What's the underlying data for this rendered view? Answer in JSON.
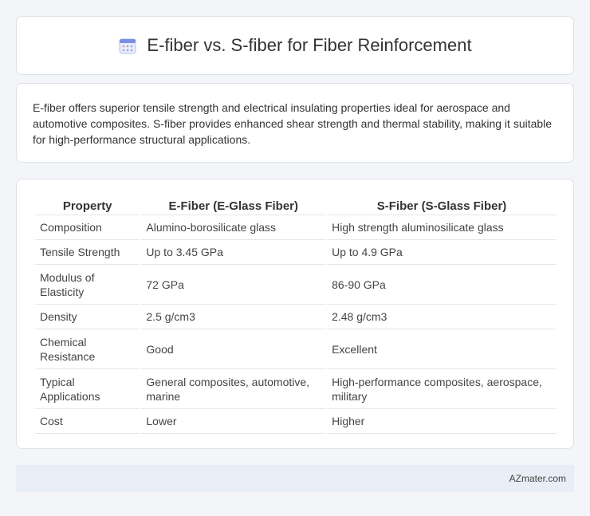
{
  "header": {
    "title": "E-fiber vs. S-fiber for Fiber Reinforcement",
    "icon": "calendar-icon"
  },
  "intro": {
    "text": "E-fiber offers superior tensile strength and electrical insulating properties ideal for aerospace and automotive composites. S-fiber provides enhanced shear strength and thermal stability, making it suitable for high-performance structural applications."
  },
  "table": {
    "headers": [
      "Property",
      "E-Fiber (E-Glass Fiber)",
      "S-Fiber (S-Glass Fiber)"
    ],
    "rows": [
      [
        "Composition",
        "Alumino-borosilicate glass",
        "High strength aluminosilicate glass"
      ],
      [
        "Tensile Strength",
        "Up to 3.45 GPa",
        "Up to 4.9 GPa"
      ],
      [
        "Modulus of Elasticity",
        "72 GPa",
        "86-90 GPa"
      ],
      [
        "Density",
        "2.5 g/cm3",
        "2.48 g/cm3"
      ],
      [
        "Chemical Resistance",
        "Good",
        "Excellent"
      ],
      [
        "Typical Applications",
        "General composites, automotive, marine",
        "High-performance composites, aerospace, military"
      ],
      [
        "Cost",
        "Lower",
        "Higher"
      ]
    ]
  },
  "footer": {
    "site": "AZmater.com"
  }
}
